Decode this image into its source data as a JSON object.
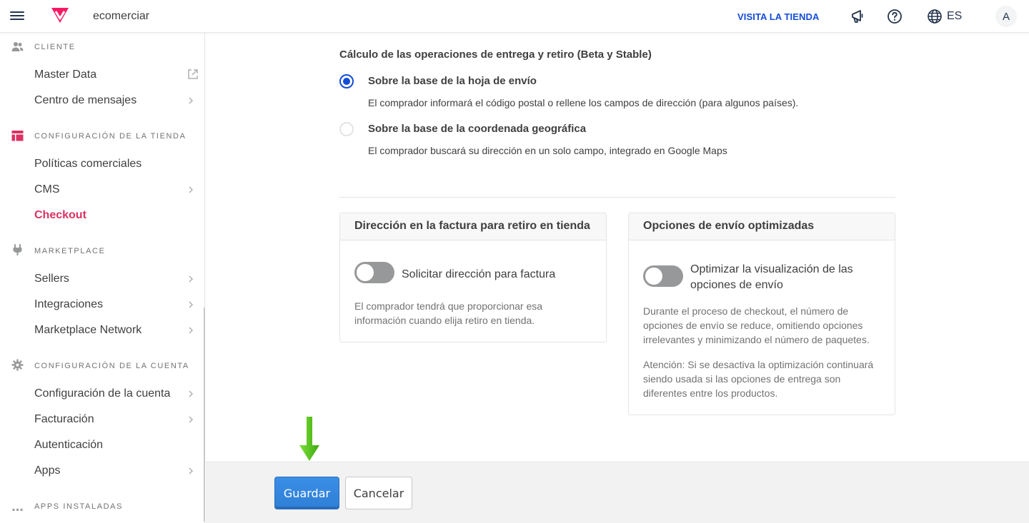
{
  "topbar": {
    "store_name": "ecomerciar",
    "visit_store": "VISITA LA TIENDA",
    "language": "ES",
    "avatar_initial": "A"
  },
  "sidebar": {
    "sections": [
      {
        "header": "CLIENTE",
        "icon": "users-icon",
        "items": [
          {
            "label": "Master Data",
            "icon": "external-link-icon"
          },
          {
            "label": "Centro de mensajes"
          }
        ]
      },
      {
        "header": "CONFIGURACIÓN DE LA TIENDA",
        "icon": "store-layout-icon",
        "items": [
          {
            "label": "Políticas comerciales"
          },
          {
            "label": "CMS"
          },
          {
            "label": "Checkout",
            "active": true
          }
        ]
      },
      {
        "header": "MARKETPLACE",
        "icon": "plug-icon",
        "items": [
          {
            "label": "Sellers"
          },
          {
            "label": "Integraciones"
          },
          {
            "label": "Marketplace Network"
          }
        ]
      },
      {
        "header": "CONFIGURACIÓN DE LA CUENTA",
        "icon": "gear-icon",
        "items": [
          {
            "label": "Configuración de la cuenta"
          },
          {
            "label": "Facturación"
          },
          {
            "label": "Autenticación"
          },
          {
            "label": "Apps"
          }
        ]
      },
      {
        "header": "APPS INSTALADAS",
        "icon": "more-dots-icon",
        "items": []
      }
    ]
  },
  "main": {
    "section_title": "Cálculo de las operaciones de entrega y retiro (Beta y Stable)",
    "options": [
      {
        "title": "Sobre la base de la hoja de envío",
        "description": "El comprador informará el código postal o rellene los campos de dirección (para algunos países).",
        "selected": true
      },
      {
        "title": "Sobre la base de la coordenada geográfica",
        "description": "El comprador buscará su dirección en un solo campo, integrado en Google Maps",
        "selected": false
      }
    ],
    "card_invoice": {
      "title": "Dirección en la factura para retiro en tienda",
      "toggle_label": "Solicitar dirección para factura",
      "toggle_on": false,
      "description": "El comprador tendrá que proporcionar esa información cuando elija retiro en tienda."
    },
    "card_shipping": {
      "title": "Opciones de envío optimizadas",
      "toggle_label": "Optimizar la visualización de las opciones de envío",
      "toggle_on": false,
      "description": "Durante el proceso de checkout, el número de opciones de envío se reduce, omitiendo opciones irrelevantes y minimizando el número de paquetes.",
      "warning": "Atención: Si se desactiva la optimización continuará siendo usada si las opciones de entrega son diferentes entre los productos."
    }
  },
  "footer": {
    "save_label": "Guardar",
    "cancel_label": "Cancelar"
  },
  "colors": {
    "brand": "#f71963",
    "accent_blue": "#134cd8",
    "active_item": "#dc3262",
    "save_button": "#368df7",
    "annotation_arrow": "#5fcf1e"
  }
}
